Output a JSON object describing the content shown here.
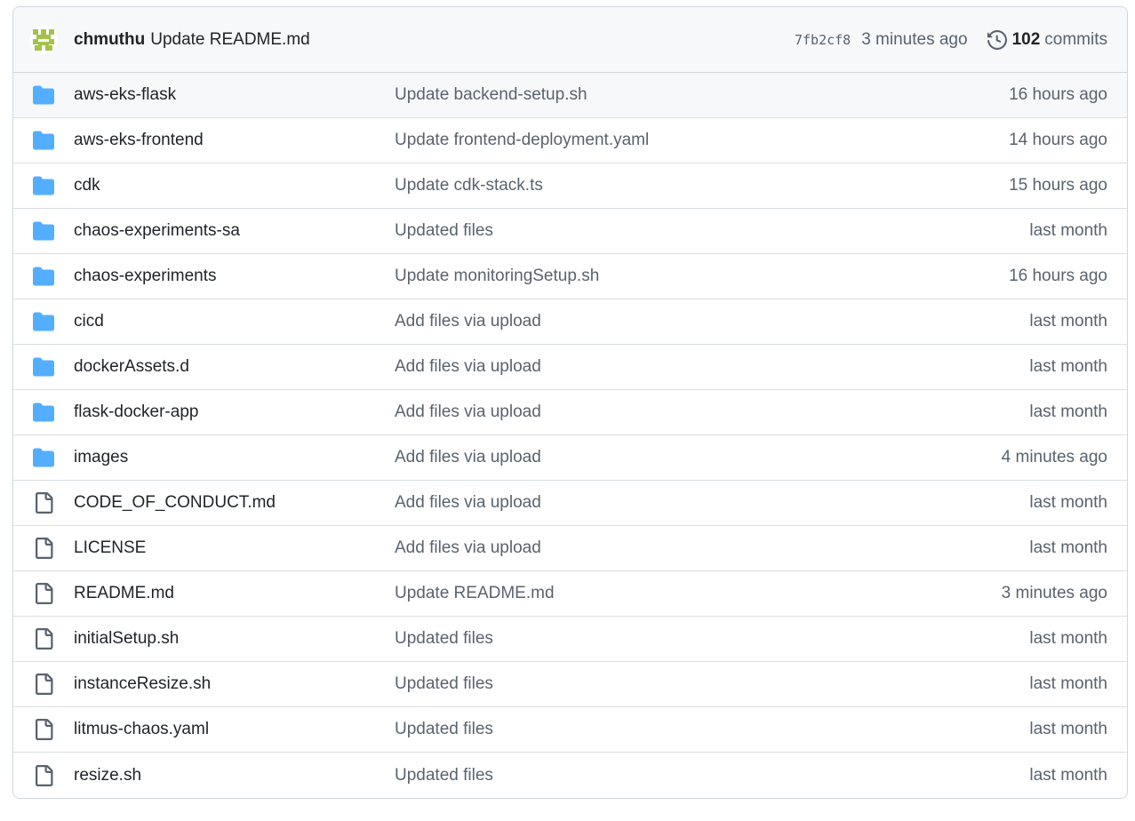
{
  "latest_commit": {
    "author": "chmuthu",
    "message": "Update README.md",
    "sha": "7fb2cf8",
    "time": "3 minutes ago",
    "commit_count": "102",
    "commit_word": "commits"
  },
  "colors": {
    "folder": "#54aeff",
    "file_icon": "#59636e",
    "avatar": "#a3c24a"
  },
  "files": [
    {
      "type": "folder",
      "icon": "folder-icon",
      "name": "aws-eks-flask",
      "message": "Update backend-setup.sh",
      "age": "16 hours ago"
    },
    {
      "type": "folder",
      "icon": "folder-icon",
      "name": "aws-eks-frontend",
      "message": "Update frontend-deployment.yaml",
      "age": "14 hours ago"
    },
    {
      "type": "folder",
      "icon": "folder-icon",
      "name": "cdk",
      "message": "Update cdk-stack.ts",
      "age": "15 hours ago"
    },
    {
      "type": "folder",
      "icon": "folder-icon",
      "name": "chaos-experiments-sa",
      "message": "Updated files",
      "age": "last month"
    },
    {
      "type": "folder",
      "icon": "folder-icon",
      "name": "chaos-experiments",
      "message": "Update monitoringSetup.sh",
      "age": "16 hours ago"
    },
    {
      "type": "folder",
      "icon": "folder-icon",
      "name": "cicd",
      "message": "Add files via upload",
      "age": "last month"
    },
    {
      "type": "folder",
      "icon": "folder-icon",
      "name": "dockerAssets.d",
      "message": "Add files via upload",
      "age": "last month"
    },
    {
      "type": "folder",
      "icon": "folder-icon",
      "name": "flask-docker-app",
      "message": "Add files via upload",
      "age": "last month"
    },
    {
      "type": "folder",
      "icon": "folder-icon",
      "name": "images",
      "message": "Add files via upload",
      "age": "4 minutes ago"
    },
    {
      "type": "file",
      "icon": "file-icon",
      "name": "CODE_OF_CONDUCT.md",
      "message": "Add files via upload",
      "age": "last month"
    },
    {
      "type": "file",
      "icon": "file-icon",
      "name": "LICENSE",
      "message": "Add files via upload",
      "age": "last month"
    },
    {
      "type": "file",
      "icon": "file-icon",
      "name": "README.md",
      "message": "Update README.md",
      "age": "3 minutes ago"
    },
    {
      "type": "file",
      "icon": "file-icon",
      "name": "initialSetup.sh",
      "message": "Updated files",
      "age": "last month"
    },
    {
      "type": "file",
      "icon": "file-icon",
      "name": "instanceResize.sh",
      "message": "Updated files",
      "age": "last month"
    },
    {
      "type": "file",
      "icon": "file-icon",
      "name": "litmus-chaos.yaml",
      "message": "Updated files",
      "age": "last month"
    },
    {
      "type": "file",
      "icon": "file-icon",
      "name": "resize.sh",
      "message": "Updated files",
      "age": "last month"
    }
  ]
}
